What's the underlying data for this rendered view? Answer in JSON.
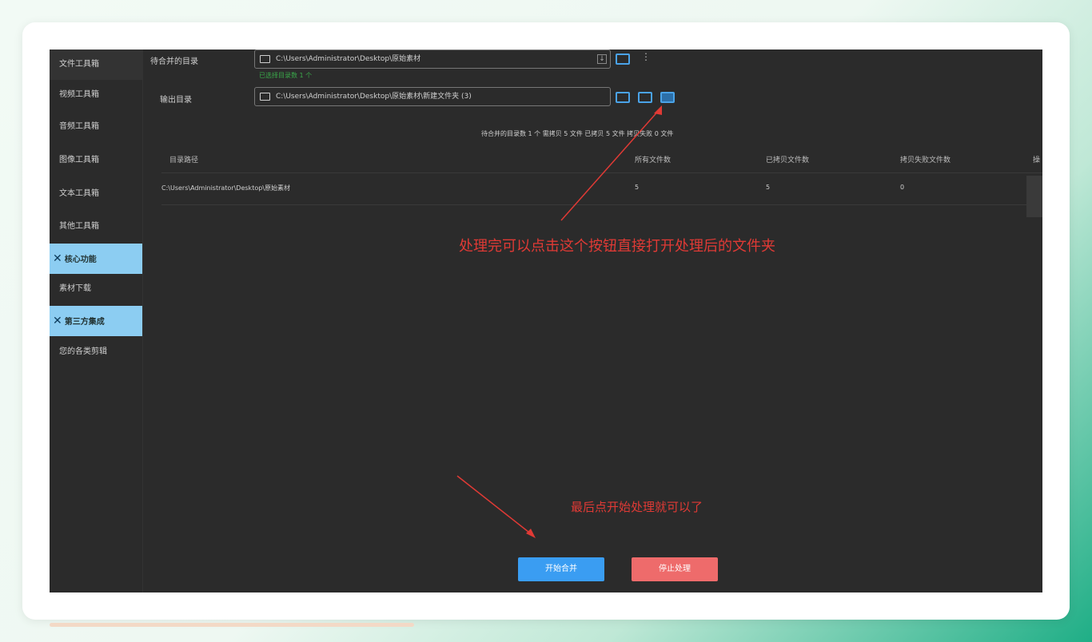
{
  "sidebar": {
    "items": [
      {
        "label": "文件工具箱"
      },
      {
        "label": "视频工具箱"
      },
      {
        "label": "音频工具箱"
      },
      {
        "label": "图像工具箱"
      },
      {
        "label": "文本工具箱"
      },
      {
        "label": "其他工具箱"
      },
      {
        "label": "核心功能",
        "x": "✕"
      },
      {
        "label": "素材下载"
      },
      {
        "label": "第三方集成",
        "x": "✕"
      },
      {
        "label": "您的各类剪辑"
      }
    ]
  },
  "form": {
    "source_label": "待合并的目录",
    "source_path": "C:\\Users\\Administrator\\Desktop\\原始素材",
    "source_hint": "已选择目录数 1 个",
    "output_label": "输出目录",
    "output_path": "C:\\Users\\Administrator\\Desktop\\原始素材\\新建文件夹 (3)",
    "download_glyph": "↓",
    "more_glyph": "⋮"
  },
  "stats": {
    "text": "待合并的目录数 1 个  需拷贝 5 文件  已拷贝 5 文件  拷贝失败 0 文件"
  },
  "table": {
    "columns": [
      "目录路径",
      "所有文件数",
      "已拷贝文件数",
      "拷贝失败文件数",
      "操"
    ],
    "rows": [
      {
        "path": "C:\\Users\\Administrator\\Desktop\\原始素材",
        "total": "5",
        "copied": "5",
        "failed": "0"
      }
    ]
  },
  "annotations": {
    "top": "处理完可以点击这个按钮直接打开处理后的文件夹",
    "bottom": "最后点开始处理就可以了"
  },
  "buttons": {
    "start": "开始合并",
    "stop": "停止处理"
  },
  "colors": {
    "accent_blue": "#3a9df2",
    "stop_red": "#ee6b6b",
    "annotation_red": "#e03a35",
    "sidebar_section": "#8ccdf2",
    "background": "#2b2b2b"
  }
}
